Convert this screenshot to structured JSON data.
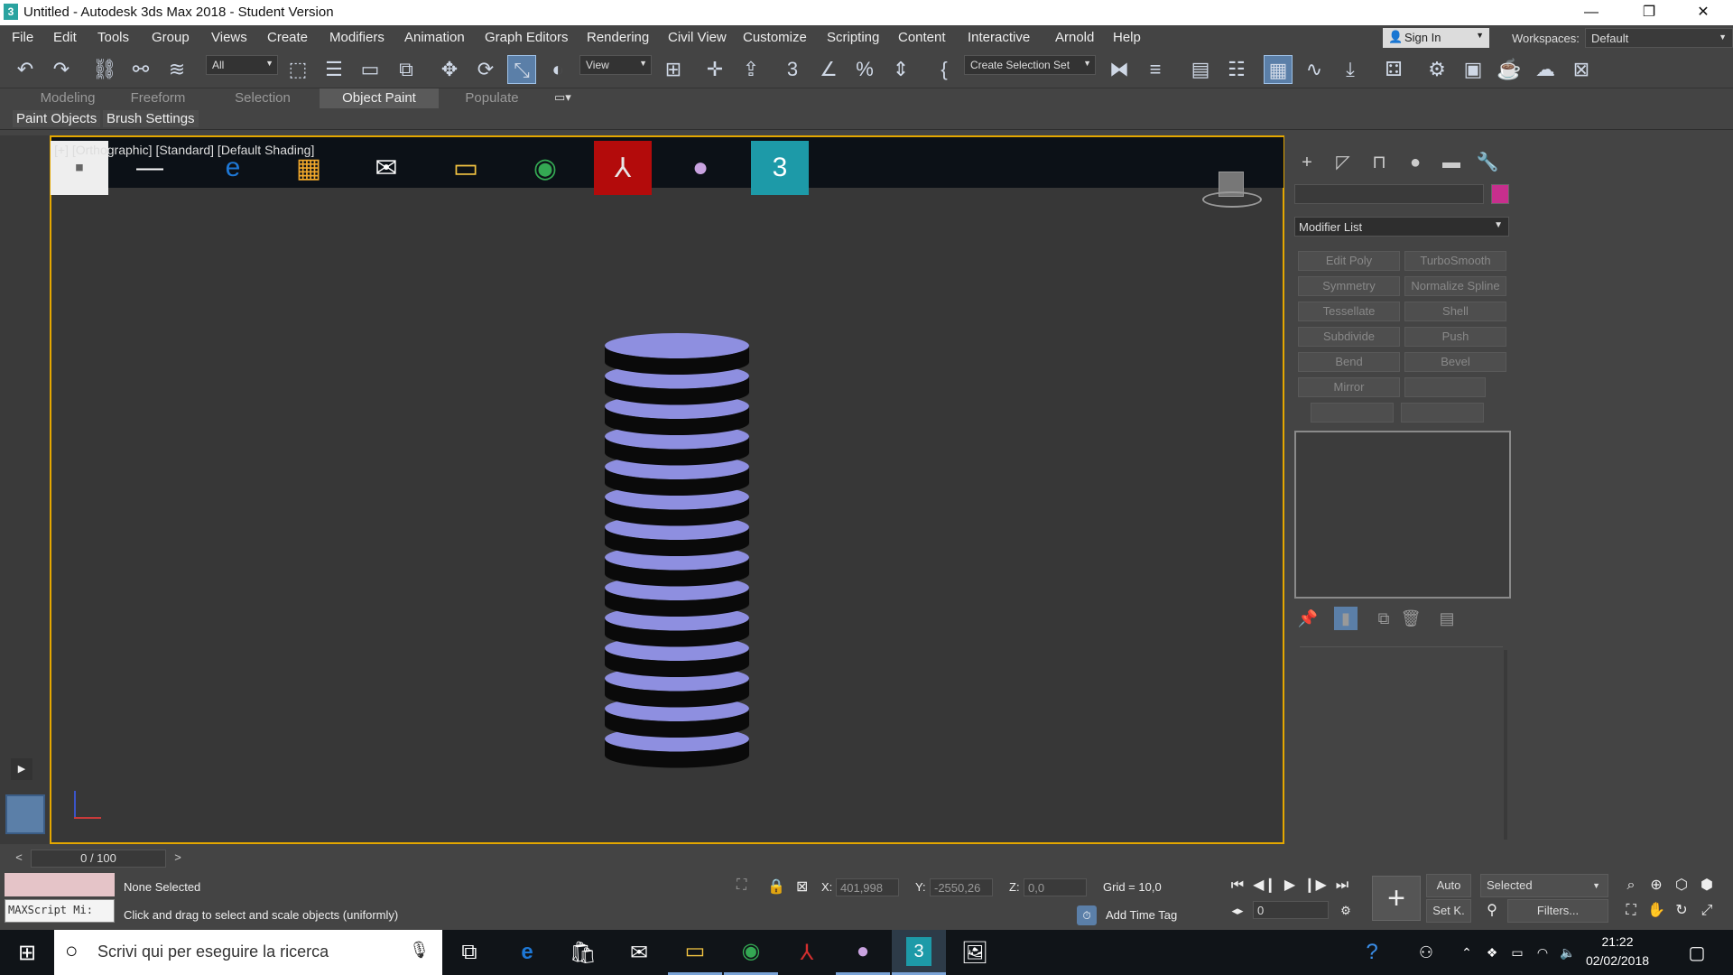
{
  "window": {
    "title": "Untitled - Autodesk 3ds Max 2018 - Student Version",
    "app_icon": "3",
    "minimize": "—",
    "restore": "❐",
    "close": "✕"
  },
  "menu": [
    "File",
    "Edit",
    "Tools",
    "Group",
    "Views",
    "Create",
    "Modifiers",
    "Animation",
    "Graph Editors",
    "Rendering",
    "Civil View",
    "Customize",
    "Scripting",
    "Content",
    "Interactive",
    "Arnold",
    "Help"
  ],
  "account": {
    "sign_in": "Sign In",
    "workspaces_label": "Workspaces:",
    "workspace": "Default"
  },
  "toolbar": {
    "filter": "All",
    "ref_coord": "View",
    "selection_set": "Create Selection Set"
  },
  "ribbon_tabs": [
    "Modeling",
    "Freeform",
    "Selection",
    "Object Paint",
    "Populate"
  ],
  "ribbon_sub": [
    "Paint Objects",
    "Brush Settings"
  ],
  "viewport": {
    "label": "[+] [Orthographic] [Standard] [Default Shading]"
  },
  "command_panel": {
    "modifier_list": "Modifier List",
    "modifier_buttons": [
      "Edit Poly",
      "TurboSmooth",
      "Symmetry",
      "Normalize Spline",
      "Tessellate",
      "Shell",
      "Subdivide",
      "Push",
      "Bend",
      "Bevel",
      "Mirror",
      "",
      "",
      ""
    ],
    "color": "#c72f8d"
  },
  "timeline": {
    "frame": "0 / 100",
    "prev": "<",
    "next": ">"
  },
  "status": {
    "selection": "None Selected",
    "prompt": "Click and drag to select and scale objects (uniformly)",
    "maxscript": "MAXScript Mi:",
    "x_label": "X:",
    "x": "401,998",
    "y_label": "Y:",
    "y": "-2550,26",
    "z_label": "Z:",
    "z": "0,0",
    "grid": "Grid = 10,0",
    "add_time_tag": "Add Time Tag",
    "auto": "Auto",
    "selected": "Selected",
    "set_key": "Set K.",
    "filters": "Filters...",
    "frame_spinner": "0"
  },
  "taskbar": {
    "search_placeholder": "Scrivi qui per eseguire la ricerca",
    "time": "21:22",
    "date": "02/02/2018"
  }
}
